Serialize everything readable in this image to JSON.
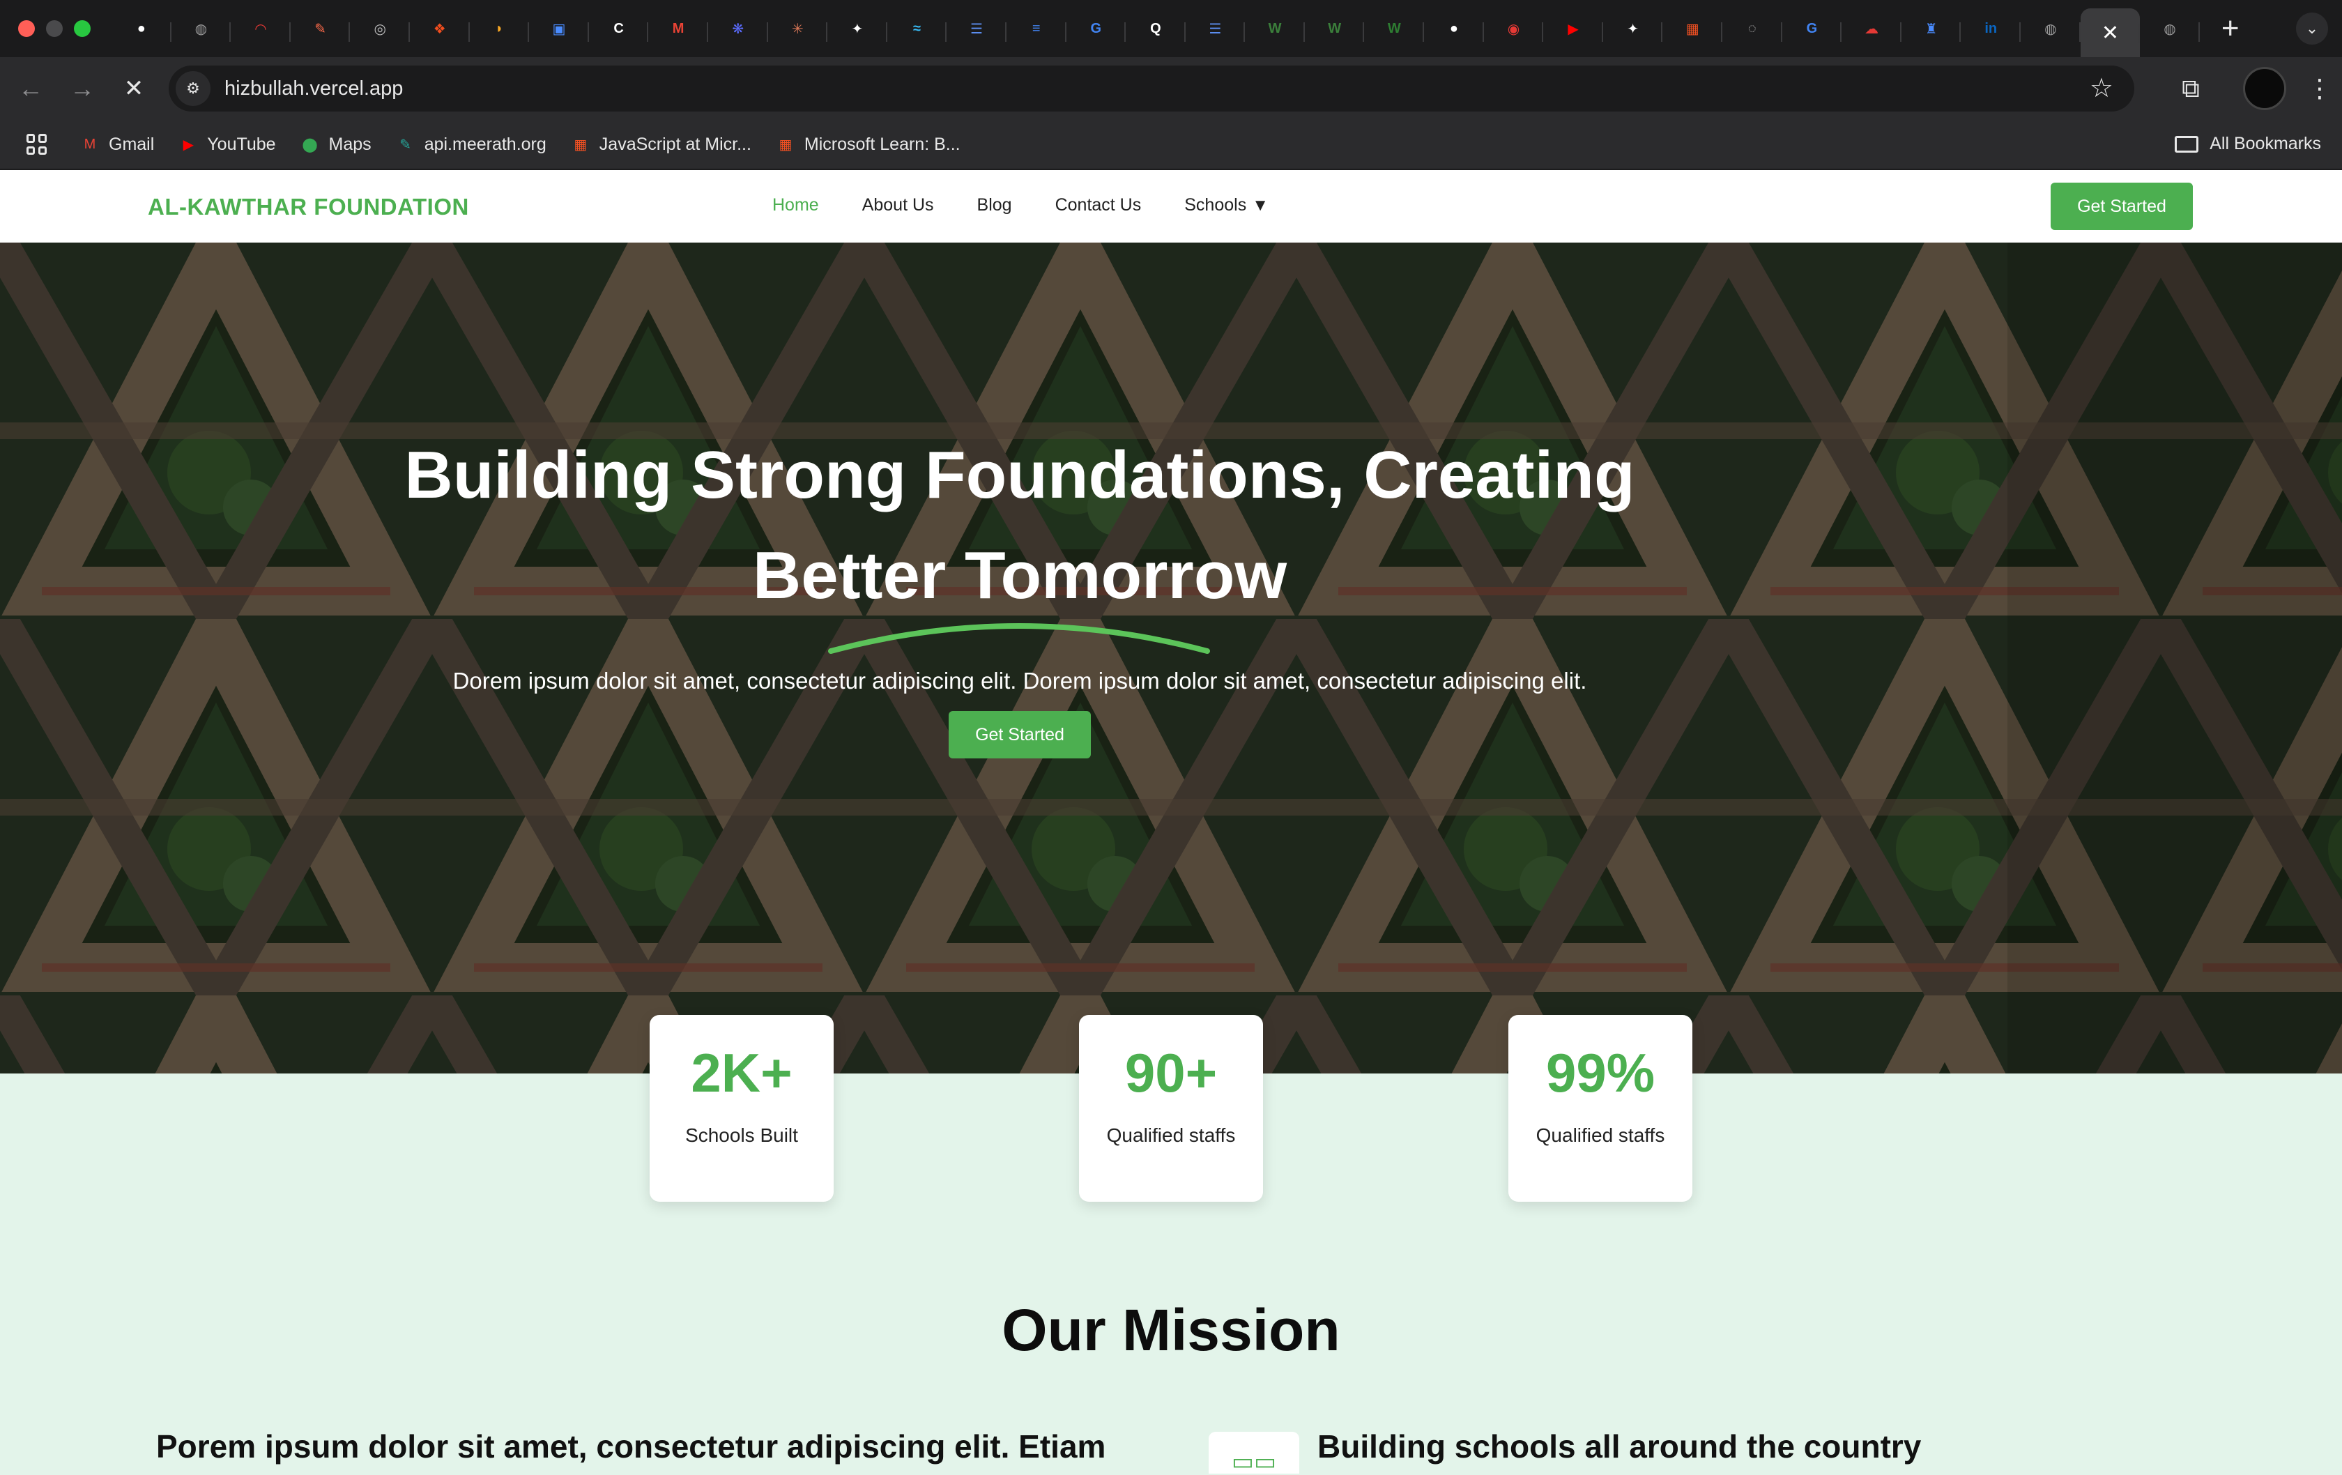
{
  "browser": {
    "tabs": [
      {
        "icon": "github-icon",
        "glyph": "●",
        "color": "#ffffff"
      },
      {
        "icon": "globe-icon",
        "glyph": "◍",
        "color": "#9a9a9a"
      },
      {
        "icon": "speedometer-icon",
        "glyph": "◠",
        "color": "#e53935"
      },
      {
        "icon": "app-icon-orange",
        "glyph": "✎",
        "color": "#ff6b4a"
      },
      {
        "icon": "target-icon",
        "glyph": "◎",
        "color": "#bdbdbd"
      },
      {
        "icon": "figma-icon",
        "glyph": "❖",
        "color": "#f24e1e"
      },
      {
        "icon": "rainbow-icon",
        "glyph": "◗",
        "color": "#f9a825"
      },
      {
        "icon": "window-icon",
        "glyph": "▣",
        "color": "#4a8cff"
      },
      {
        "icon": "c-icon",
        "glyph": "C",
        "color": "#ffffff"
      },
      {
        "icon": "gmail-icon",
        "glyph": "M",
        "color": "#ea4335"
      },
      {
        "icon": "bird-icon",
        "glyph": "❋",
        "color": "#5b6cff"
      },
      {
        "icon": "sparkle-icon",
        "glyph": "✳",
        "color": "#d97757"
      },
      {
        "icon": "openai-icon",
        "glyph": "✦",
        "color": "#ffffff"
      },
      {
        "icon": "tailwind-icon",
        "glyph": "≈",
        "color": "#38bdf8"
      },
      {
        "icon": "list-icon",
        "glyph": "☰",
        "color": "#5b8def"
      },
      {
        "icon": "docs-icon",
        "glyph": "≡",
        "color": "#4285f4"
      },
      {
        "icon": "google-icon",
        "glyph": "G",
        "color": "#4285f4"
      },
      {
        "icon": "q-icon",
        "glyph": "Q",
        "color": "#ffffff"
      },
      {
        "icon": "list-icon",
        "glyph": "☰",
        "color": "#5b8def"
      },
      {
        "icon": "w-icon",
        "glyph": "W",
        "color": "#3b7f3b"
      },
      {
        "icon": "w-icon",
        "glyph": "W",
        "color": "#3b7f3b"
      },
      {
        "icon": "w-icon",
        "glyph": "W",
        "color": "#2e7d32"
      },
      {
        "icon": "github-icon",
        "glyph": "●",
        "color": "#ffffff"
      },
      {
        "icon": "record-icon",
        "glyph": "◉",
        "color": "#e53935"
      },
      {
        "icon": "youtube-icon",
        "glyph": "▶",
        "color": "#ff0000"
      },
      {
        "icon": "openai-icon",
        "glyph": "✦",
        "color": "#ffffff"
      },
      {
        "icon": "microsoft-icon",
        "glyph": "▦",
        "color": "#f25022"
      },
      {
        "icon": "loading-icon",
        "glyph": "◌",
        "color": "#bdbdbd"
      },
      {
        "icon": "google-icon",
        "glyph": "G",
        "color": "#4285f4"
      },
      {
        "icon": "cloud-icon",
        "glyph": "☁",
        "color": "#e53935"
      },
      {
        "icon": "figure-icon",
        "glyph": "♜",
        "color": "#4a8cff"
      },
      {
        "icon": "linkedin-icon",
        "glyph": "in",
        "color": "#0a66c2"
      },
      {
        "icon": "globe-icon",
        "glyph": "◍",
        "color": "#9a9a9a"
      },
      {
        "icon": "close-icon",
        "glyph": "✕",
        "color": "#ffffff",
        "active": true
      },
      {
        "icon": "globe-icon",
        "glyph": "◍",
        "color": "#9a9a9a"
      }
    ],
    "new_tab": "+",
    "tab_menu": "⌄",
    "url": "hizbullah.vercel.app",
    "bookmarks": [
      {
        "label": "Gmail",
        "icon": "gmail-icon",
        "glyph": "M",
        "color": "#ea4335"
      },
      {
        "label": "YouTube",
        "icon": "youtube-icon",
        "glyph": "▶",
        "color": "#ff0000"
      },
      {
        "label": "Maps",
        "icon": "maps-pin-icon",
        "glyph": "⬤",
        "color": "#34a853"
      },
      {
        "label": "api.meerath.org",
        "icon": "feather-icon",
        "glyph": "✎",
        "color": "#26a69a"
      },
      {
        "label": "JavaScript at Micr...",
        "icon": "microsoft-icon",
        "glyph": "▦",
        "color": "#f25022"
      },
      {
        "label": "Microsoft Learn: B...",
        "icon": "microsoft-icon",
        "glyph": "▦",
        "color": "#f25022"
      }
    ],
    "all_bookmarks": "All Bookmarks"
  },
  "site": {
    "brand": "AL-KAWTHAR FOUNDATION",
    "nav": [
      {
        "label": "Home",
        "active": true
      },
      {
        "label": "About Us"
      },
      {
        "label": "Blog"
      },
      {
        "label": "Contact Us"
      },
      {
        "label": "Schools"
      }
    ],
    "nav_cta": "Get Started",
    "hero": {
      "title_line1": "Building Strong Foundations, Creating",
      "title_line2": "Better Tomorrow",
      "subtitle": "Dorem ipsum dolor sit amet, consectetur adipiscing elit. Dorem ipsum dolor sit amet, consectetur adipiscing elit.",
      "cta": "Get Started"
    },
    "stats": [
      {
        "value": "2K+",
        "label": "Schools Built"
      },
      {
        "value": "90+",
        "label": "Qualified staffs"
      },
      {
        "value": "99%",
        "label": "Qualified staffs"
      }
    ],
    "mission": {
      "title": "Our Mission",
      "left_heading": "Porem ipsum dolor sit amet, consectetur adipiscing elit. Etiam",
      "right_heading": "Building schools all around the country"
    }
  },
  "colors": {
    "accent": "#4caf50",
    "mint_bg": "#e3f4ea",
    "chrome_dark": "#1b1b1c"
  }
}
